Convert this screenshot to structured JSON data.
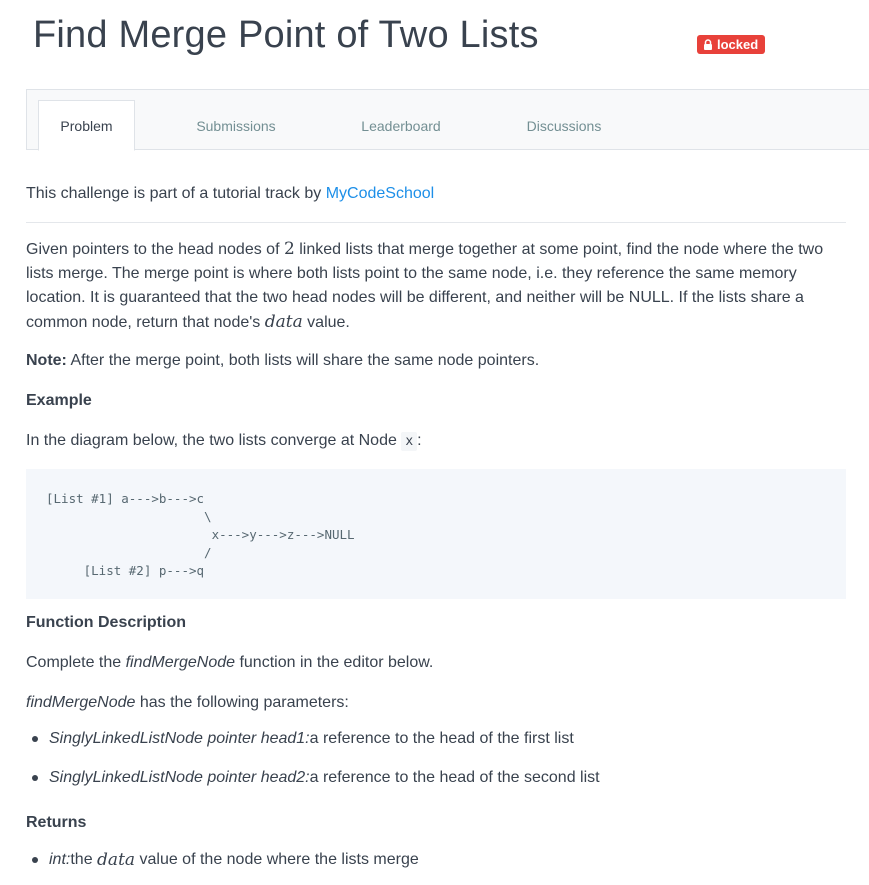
{
  "title": "Find Merge Point of Two Lists",
  "badge": {
    "label": "locked",
    "icon": "lock-icon",
    "color": "#e8413a"
  },
  "tabs": [
    {
      "label": "Problem",
      "active": true
    },
    {
      "label": "Submissions",
      "active": false
    },
    {
      "label": "Leaderboard",
      "active": false
    },
    {
      "label": "Discussions",
      "active": false
    }
  ],
  "track": {
    "prefix": "This challenge is part of a tutorial track by ",
    "link": "MyCodeSchool"
  },
  "description": {
    "p1_part1": "Given pointers to the head nodes of ",
    "p1_num": "2",
    "p1_part2": " linked lists that merge together at some point, find the node where the two lists merge. The merge point is where both lists point to the same node, i.e. they reference the same memory location. It is guaranteed that the two head nodes will be different, and neither will be NULL. If the lists share a common node, return that node's ",
    "p1_var": "data",
    "p1_part3": " value.",
    "note_label": "Note:",
    "note_text": " After the merge point, both lists will share the same node pointers."
  },
  "example": {
    "heading": "Example",
    "intro": "In the diagram below, the two lists converge at Node ",
    "node": "x",
    "intro_end": ":",
    "diagram": "[List #1] a--->b--->c\n                     \\\n                      x--->y--->z--->NULL\n                     /\n     [List #2] p--->q"
  },
  "function_description": {
    "heading": "Function Description",
    "text_prefix": "Complete the ",
    "fn_name": "findMergeNode",
    "text_suffix": " function in the editor below.",
    "params_fn": "findMergeNode",
    "params_suffix": " has the following parameters:",
    "params": [
      {
        "name": "SinglyLinkedListNode pointer head1:",
        "desc": " a reference to the head of the first list"
      },
      {
        "name": "SinglyLinkedListNode pointer head2:",
        "desc": " a reference to the head of the second list"
      }
    ]
  },
  "returns": {
    "heading": "Returns",
    "type": "int:",
    "text_prefix": " the ",
    "var": "data",
    "text_suffix": " value of the node where the lists merge"
  }
}
